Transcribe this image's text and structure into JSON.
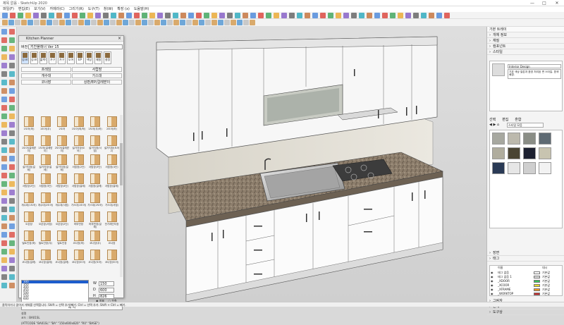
{
  "app": {
    "title": "제목 없음 - SketchUp 2020",
    "window_controls": [
      "—",
      "□",
      "✕"
    ]
  },
  "menu": [
    "파일(F)",
    "편집(E)",
    "보기(V)",
    "카메라(C)",
    "그리기(R)",
    "도구(T)",
    "창(W)",
    "확장 (x)",
    "도움말(H)"
  ],
  "kitchen_planner": {
    "title": "Kitchen Planner",
    "version_label": "버전",
    "version_value": "키친플래너 Ver 15",
    "categories": [
      {
        "label": "싱크대하부장",
        "icon": "cabinet-icon",
        "selected": true
      },
      {
        "label": "싱크대상부장",
        "icon": "cabinet-icon",
        "selected": false
      },
      {
        "label": "붙박이장",
        "icon": "wardrobe-icon",
        "selected": false
      },
      {
        "label": "가구",
        "icon": "furniture-icon",
        "selected": false
      },
      {
        "label": "가구",
        "icon": "furniture-icon",
        "selected": false
      },
      {
        "label": "도어",
        "icon": "door-icon",
        "selected": false
      },
      {
        "label": "EP",
        "icon": "panel-icon",
        "selected": false
      },
      {
        "label": "색상",
        "icon": "color-icon",
        "selected": false
      },
      {
        "label": "재질",
        "icon": "material-icon",
        "selected": false
      },
      {
        "label": "설정",
        "icon": "gear-icon",
        "selected": false
      }
    ],
    "subtabs": [
      {
        "label": "프레임",
        "row": 1
      },
      {
        "label": "서랍장",
        "row": 1
      },
      {
        "label": "개수대",
        "row": 2
      },
      {
        "label": "가스대",
        "row": 2
      },
      {
        "label": "코너장",
        "row": 3
      },
      {
        "label": "상판/EP/걸레받이",
        "row": 3
      }
    ],
    "items": [
      "1도어(좌)",
      "1도어(우)",
      "2도어",
      "1도어(좌/하)",
      "1도어(우/하)",
      "2도어(하)",
      "1도어(걸레받이)",
      "1도어(걸레받이)",
      "2도어(걸레받이)",
      "설거지장(도어)",
      "설거지장(서랍)",
      "설거지장(도어2)",
      "설거지장(걸레)",
      "설거지장(걸레)",
      "설거지장(걸레)",
      "서랍장(2단)",
      "서랍장(3단)",
      "서랍장(4단)",
      "서랍장(2단)",
      "서랍장(3단)",
      "서랍장(4단)",
      "서랍장(걸레)",
      "서랍장(걸레)",
      "서랍장(걸레)",
      "개수대(1도어)",
      "개수대(2도어)",
      "개수대(서랍)",
      "가스대(1도어)",
      "가스대(2도어)",
      "가스대(서랍)",
      "오븐장",
      "오븐장(서랍)",
      "오븐장(2단)",
      "하부빈장",
      "하부빈장(걸레)",
      "전기레인지장",
      "빌트인장(좌)",
      "빌트인장(우)",
      "빌트인장",
      "코너장(좌)",
      "코너장(우)",
      "코너장",
      "코너장(걸레)",
      "코너장(걸레)",
      "코너장(걸레)",
      "코너장(도어)",
      "코너장(도어)",
      "코너장(도어)"
    ],
    "sizes": [
      "300",
      "350",
      "400",
      "450",
      "500",
      "550",
      "600"
    ],
    "dims": [
      {
        "key": "W",
        "value": "150"
      },
      {
        "key": "D",
        "value": "600"
      },
      {
        "key": "H",
        "value": "826"
      }
    ],
    "radio_options": [
      "좌표",
      "우측"
    ],
    "place_button": "배 치",
    "info_lines": [
      "설명",
      "코드 : BA01SL",
      "(ATTCODE \"BA01SL\" \"BA\" \"150x600x820\" \"R0\" \"BASE\")"
    ]
  },
  "right_panel": {
    "title": "기본 트레이",
    "sections_top": [
      "개체 정보",
      "재질",
      "컴포넌트",
      "스타일"
    ],
    "material": {
      "name": "Interior Design",
      "desc": "기본 색상 질감과 음영 처리된 면 스타일. 흰색 배경."
    },
    "mat_tabs": [
      "선택",
      "편집",
      "혼합"
    ],
    "mat_filter": "스타일 모음",
    "swatch_colors": [
      "#a7a8a0",
      "#bcb9ad",
      "#8a8d86",
      "#5e6a73",
      "#b0ad9e",
      "#4a4433",
      "#1c2030",
      "#c8c4b0",
      "#2a3a55",
      "#e6e6e6",
      "#cfcfcf",
      "#f2f2f2"
    ],
    "sections_mid": [
      "장면",
      "태그"
    ],
    "tag_headers": [
      "이름",
      "대시"
    ],
    "tags": [
      {
        "name": "태그 없음",
        "color": "#ffffff",
        "dash": "기본값"
      },
      {
        "name": "태그 없음 1",
        "color": "#dddddd",
        "dash": "기본값"
      },
      {
        "name": "_XDOOR",
        "color": "#39c45a",
        "dash": "기본값"
      },
      {
        "name": "_XCOOR",
        "color": "#e5d72a",
        "dash": "기본값"
      },
      {
        "name": "_XFRAME",
        "color": "#f1961f",
        "dash": "기본값"
      },
      {
        "name": "_WORKTOP",
        "color": "#c62a2a",
        "dash": "기본값"
      }
    ],
    "sections_bottom": [
      "그림자",
      "안개",
      "도구상"
    ]
  },
  "status_text": "클릭하거나 끌어서 개체를 선택합니다. Shift = 선택 추가/빼기. Ctrl = 선택 추가. Shift + Ctrl = 빼기."
}
